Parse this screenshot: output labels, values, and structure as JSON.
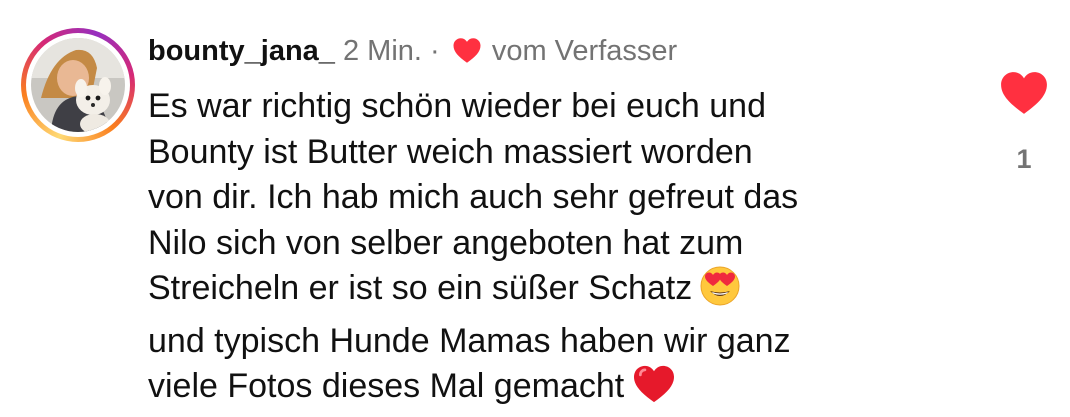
{
  "comment": {
    "username": "bounty_jana_",
    "time": "2 Min.",
    "separator": "·",
    "liked_by_author_label": "vom Verfasser",
    "lines": [
      "Es war richtig schön wieder bei euch und",
      "Bounty ist Butter weich massiert worden",
      "von dir. Ich hab mich auch sehr gefreut das",
      "Nilo sich von selber angeboten hat zum",
      "Streicheln er ist so ein süßer Schatz",
      "und typisch Hunde Mamas haben wir ganz",
      "viele Fotos dieses Mal gemacht"
    ],
    "emojis": {
      "line_5": "heart-eyes-emoji",
      "line_7": "red-heart-emoji"
    }
  },
  "like": {
    "count": "1",
    "icon": "heart-icon",
    "liked": true
  },
  "colors": {
    "like_red": "#ff3040",
    "meta_gray": "#737373",
    "text": "#111111",
    "story_ring": [
      "#feda75",
      "#fa7e1e",
      "#d62976",
      "#962fbf"
    ]
  }
}
